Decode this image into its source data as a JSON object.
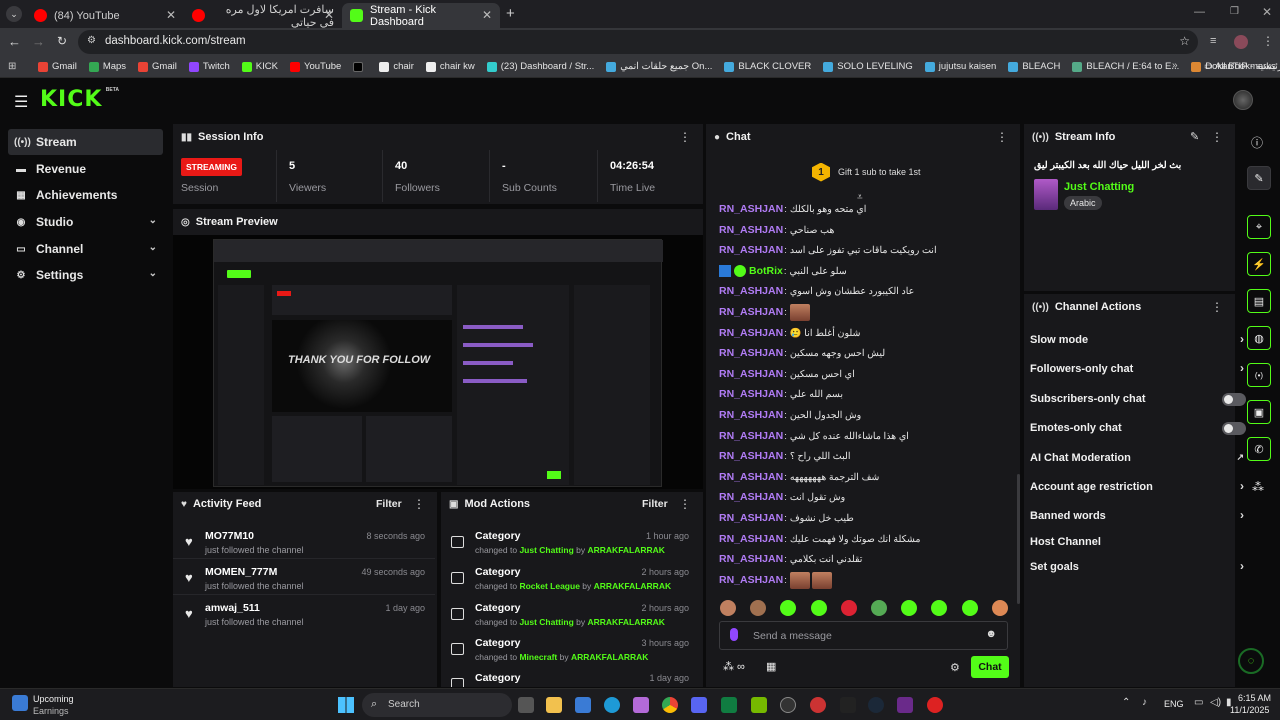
{
  "browser": {
    "tabs": [
      {
        "title": "(84) YouTube",
        "active": false
      },
      {
        "title": "سافرت امريكا لاول مره في حياتي",
        "active": false
      },
      {
        "title": "Stream - Kick Dashboard",
        "active": true
      }
    ],
    "url": "dashboard.kick.com/stream",
    "bookmarks": [
      "Gmail",
      "Maps",
      "Gmail",
      "Twitch",
      "KICK",
      "YouTube",
      "chair",
      "chair kw",
      "(23) Dashboard / Str...",
      "جميع حلقات انمي On...",
      "BLACK CLOVER",
      "SOLO LEVELING",
      "jujutsu kaisen",
      "BLEACH",
      "BLEACH / E:64 to E...",
      "DokanTIP - الرئيسية"
    ],
    "all_bookmarks": "All Bookmarks"
  },
  "kick": {
    "logo": "KICK",
    "logo_badge": "BETA",
    "brand_color": "#53fc18"
  },
  "sidebar": {
    "items": [
      {
        "label": "Stream",
        "icon": "broadcast-icon",
        "active": true,
        "expandable": false
      },
      {
        "label": "Revenue",
        "icon": "revenue-icon",
        "active": false,
        "expandable": false
      },
      {
        "label": "Achievements",
        "icon": "achievements-icon",
        "active": false,
        "expandable": false
      },
      {
        "label": "Studio",
        "icon": "studio-icon",
        "active": false,
        "expandable": true
      },
      {
        "label": "Channel",
        "icon": "channel-icon",
        "active": false,
        "expandable": true
      },
      {
        "label": "Settings",
        "icon": "gear-icon",
        "active": false,
        "expandable": true
      }
    ]
  },
  "session": {
    "title": "Session Info",
    "status_badge": "STREAMING",
    "status_label": "Session",
    "stats": [
      {
        "value": "5",
        "label": "Viewers"
      },
      {
        "value": "40",
        "label": "Followers"
      },
      {
        "value": "-",
        "label": "Sub Counts"
      },
      {
        "value": "04:26:54",
        "label": "Time Live"
      }
    ]
  },
  "preview": {
    "title": "Stream Preview",
    "overlay_text": "THANK YOU FOR FOLLOW"
  },
  "activity": {
    "title": "Activity Feed",
    "filter": "Filter",
    "items": [
      {
        "name": "MO77M10",
        "desc": "just followed the channel",
        "time": "8 seconds ago"
      },
      {
        "name": "MOMEN_777M",
        "desc": "just followed the channel",
        "time": "49 seconds ago"
      },
      {
        "name": "amwaj_511",
        "desc": "just followed the channel",
        "time": "1 day ago"
      }
    ]
  },
  "mod": {
    "title": "Mod Actions",
    "filter": "Filter",
    "items": [
      {
        "name": "Category",
        "pre": "changed to",
        "target": "Just Chatting",
        "by": "by",
        "user": "ARRAKFALARRAK",
        "time": "1 hour ago"
      },
      {
        "name": "Category",
        "pre": "changed to",
        "target": "Rocket League",
        "by": "by",
        "user": "ARRAKFALARRAK",
        "time": "2 hours ago"
      },
      {
        "name": "Category",
        "pre": "changed to",
        "target": "Just Chatting",
        "by": "by",
        "user": "ARRAKFALARRAK",
        "time": "2 hours ago"
      },
      {
        "name": "Category",
        "pre": "changed to",
        "target": "Minecraft",
        "by": "by",
        "user": "ARRAKFALARRAK",
        "time": "3 hours ago"
      },
      {
        "name": "Category",
        "pre": "",
        "target": "",
        "by": "",
        "user": "",
        "time": "1 day ago"
      }
    ]
  },
  "chat": {
    "title": "Chat",
    "gift_count": "1",
    "gift_text": "Gift 1 sub to take 1st",
    "messages": [
      {
        "user": "RN_ASHJAN",
        "text": "اي متحه وهو بالكلك",
        "emotes": 0
      },
      {
        "user": "RN_ASHJAN",
        "text": "هب صناحي",
        "emotes": 0
      },
      {
        "user": "RN_ASHJAN",
        "text": "انت رويكيت ماقات تبي تفوز على اسد",
        "emotes": 0
      },
      {
        "user": "BotRix",
        "text": "سلو على النبي",
        "emotes": 0
      },
      {
        "user": "RN_ASHJAN",
        "text": "عاد الكيبورد عطشان وش اسوي",
        "emotes": 0
      },
      {
        "user": "RN_ASHJAN",
        "text": "",
        "emotes": 1
      },
      {
        "user": "RN_ASHJAN",
        "text": "شلون أغلط انا 🥲",
        "emotes": 0
      },
      {
        "user": "RN_ASHJAN",
        "text": "ليش احس وجهه مسكين",
        "emotes": 0
      },
      {
        "user": "RN_ASHJAN",
        "text": "اي احس مسكين",
        "emotes": 0
      },
      {
        "user": "RN_ASHJAN",
        "text": "بسم الله علي",
        "emotes": 0
      },
      {
        "user": "RN_ASHJAN",
        "text": "وش الجدول الحين",
        "emotes": 0
      },
      {
        "user": "RN_ASHJAN",
        "text": "اي هذا ماشاءالله عنده كل شي",
        "emotes": 0
      },
      {
        "user": "RN_ASHJAN",
        "text": "البث اللي راح ؟",
        "emotes": 0
      },
      {
        "user": "RN_ASHJAN",
        "text": "شف الترجمة هههههههه",
        "emotes": 0
      },
      {
        "user": "RN_ASHJAN",
        "text": "وش تقول انت",
        "emotes": 0
      },
      {
        "user": "RN_ASHJAN",
        "text": "طيب خل نشوف",
        "emotes": 0
      },
      {
        "user": "RN_ASHJAN",
        "text": "مشكلة انك صوتك ولا فهمت عليك",
        "emotes": 0
      },
      {
        "user": "RN_ASHJAN",
        "text": "تقلدني انت بكلامي",
        "emotes": 0
      },
      {
        "user": "RN_ASHJAN",
        "text": "",
        "emotes": 2
      }
    ],
    "input_placeholder": "Send a message",
    "send_label": "Chat"
  },
  "stream_info": {
    "title": "Stream Info",
    "stream_title": "بث لخر الليل حياك الله بعد الكيبتر ليق",
    "category": "Just Chatting",
    "tag": "Arabic"
  },
  "channel_actions": {
    "title": "Channel Actions",
    "items": [
      {
        "label": "Slow mode",
        "control": "arrow"
      },
      {
        "label": "Followers-only chat",
        "control": "arrow"
      },
      {
        "label": "Subscribers-only chat",
        "control": "toggle"
      },
      {
        "label": "Emotes-only chat",
        "control": "toggle"
      },
      {
        "label": "AI Chat Moderation",
        "control": "external"
      },
      {
        "label": "Account age restriction",
        "control": "arrow"
      },
      {
        "label": "Banned words",
        "control": "arrow"
      },
      {
        "label": "Host Channel",
        "control": "none"
      },
      {
        "label": "Set goals",
        "control": "arrow"
      }
    ]
  },
  "taskbar": {
    "weather_title": "Upcoming",
    "weather_sub": "Earnings",
    "search": "Search",
    "lang": "ENG",
    "time": "6:15 AM",
    "date": "11/1/2025"
  }
}
